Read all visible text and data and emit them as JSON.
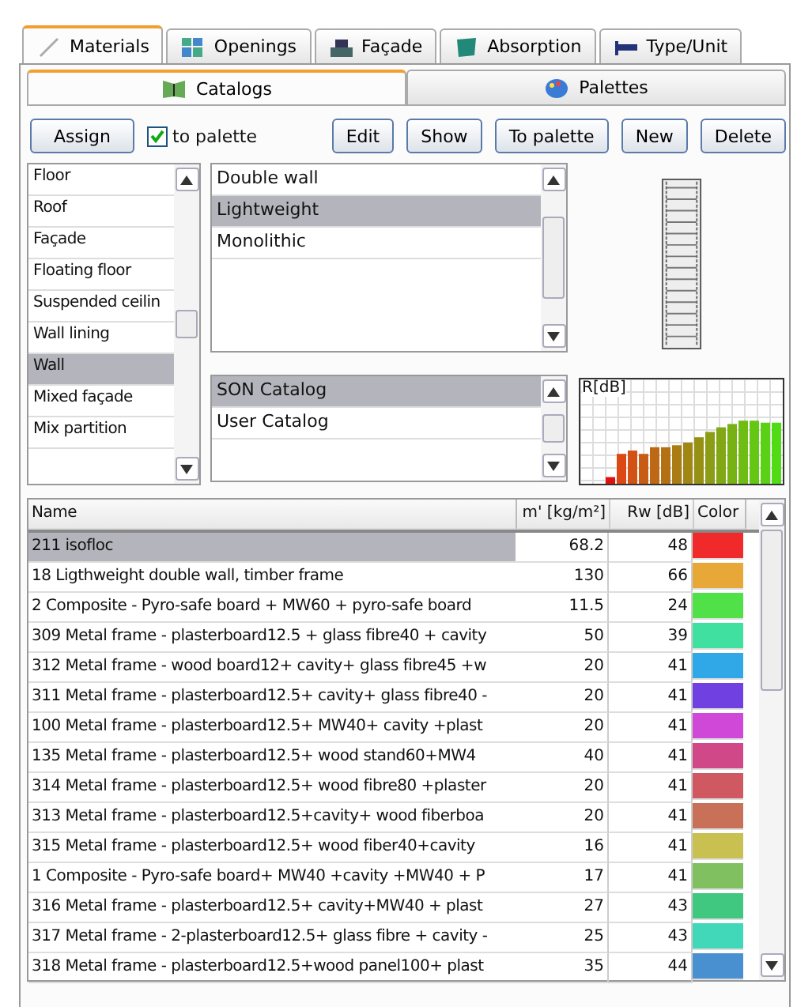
{
  "tabs": [
    {
      "label": "Materials",
      "selected": true
    },
    {
      "label": "Openings",
      "selected": false
    },
    {
      "label": "Façade",
      "selected": false
    },
    {
      "label": "Absorption",
      "selected": false
    },
    {
      "label": "Type/Unit",
      "selected": false
    }
  ],
  "subtabs": [
    {
      "label": "Catalogs",
      "selected": true
    },
    {
      "label": "Palettes",
      "selected": false
    }
  ],
  "toolbar": {
    "assign": "Assign",
    "to_palette_check": {
      "label": "to palette",
      "checked": true
    },
    "buttons": [
      "Edit",
      "Show",
      "To palette",
      "New",
      "Delete"
    ]
  },
  "categories": [
    {
      "label": "Floor",
      "selected": false
    },
    {
      "label": "Roof",
      "selected": false
    },
    {
      "label": "Façade",
      "selected": false
    },
    {
      "label": "Floating floor",
      "selected": false
    },
    {
      "label": "Suspended ceilin",
      "selected": false
    },
    {
      "label": "Wall lining",
      "selected": false
    },
    {
      "label": "Wall",
      "selected": true
    },
    {
      "label": "Mixed façade",
      "selected": false
    },
    {
      "label": "Mix partition",
      "selected": false
    }
  ],
  "types": [
    {
      "label": "Double wall",
      "selected": false
    },
    {
      "label": "Lightweight",
      "selected": true
    },
    {
      "label": "Monolithic",
      "selected": false
    }
  ],
  "catalogs": [
    {
      "label": "SON Catalog",
      "selected": true
    },
    {
      "label": "User Catalog",
      "selected": false
    }
  ],
  "chart_label": "R[dB]",
  "table": {
    "columns": [
      "Name",
      "m' [kg/m²]",
      "Rw [dB]",
      "Color"
    ],
    "rows": [
      {
        "name": "211 isofloc",
        "mass": "68.2",
        "rw": "48",
        "color": "#f02a2a",
        "selected": true
      },
      {
        "name": "18  Ligthweight double wall, timber frame",
        "mass": "130",
        "rw": "66",
        "color": "#e8a838",
        "selected": false
      },
      {
        "name": "2 Composite - Pyro-safe board + MW60 + pyro-safe board",
        "mass": "11.5",
        "rw": "24",
        "color": "#50e048",
        "selected": false
      },
      {
        "name": "309 Metal frame - plasterboard12.5 + glass fibre40 + cavity",
        "mass": "50",
        "rw": "39",
        "color": "#40e0a0",
        "selected": false
      },
      {
        "name": "312 Metal frame - wood board12+ cavity+ glass fibre45 +w",
        "mass": "20",
        "rw": "41",
        "color": "#30a8e8",
        "selected": false
      },
      {
        "name": "311 Metal frame - plasterboard12.5+ cavity+ glass fibre40 -",
        "mass": "20",
        "rw": "41",
        "color": "#7040e0",
        "selected": false
      },
      {
        "name": "100 Metal frame - plasterboard12.5+ MW40+ cavity +plast",
        "mass": "20",
        "rw": "41",
        "color": "#d048d8",
        "selected": false
      },
      {
        "name": "135  Metal frame - plasterboard12.5+ wood stand60+MW4",
        "mass": "40",
        "rw": "41",
        "color": "#d04888",
        "selected": false
      },
      {
        "name": "314 Metal frame - plasterboard12.5+ wood fibre80 +plaster",
        "mass": "20",
        "rw": "41",
        "color": "#d05860",
        "selected": false
      },
      {
        "name": "313 Metal frame - plasterboard12.5+cavity+ wood fiberboa",
        "mass": "20",
        "rw": "41",
        "color": "#c87058",
        "selected": false
      },
      {
        "name": "315 Metal frame - plasterboard12.5+ wood fiber40+cavity",
        "mass": "16",
        "rw": "41",
        "color": "#c8c050",
        "selected": false
      },
      {
        "name": "1 Composite - Pyro-safe board+ MW40 +cavity +MW40 + P",
        "mass": "17",
        "rw": "41",
        "color": "#80c060",
        "selected": false
      },
      {
        "name": "316 Metal frame - plasterboard12.5+ cavity+MW40 + plast",
        "mass": "27",
        "rw": "43",
        "color": "#40c880",
        "selected": false
      },
      {
        "name": "317 Metal frame - 2-plasterboard12.5+ glass fibre + cavity -",
        "mass": "25",
        "rw": "43",
        "color": "#40d8b8",
        "selected": false
      },
      {
        "name": "318 Metal frame - plasterboard12.5+wood panel100+ plast",
        "mass": "35",
        "rw": "44",
        "color": "#4890d0",
        "selected": false
      }
    ]
  }
}
